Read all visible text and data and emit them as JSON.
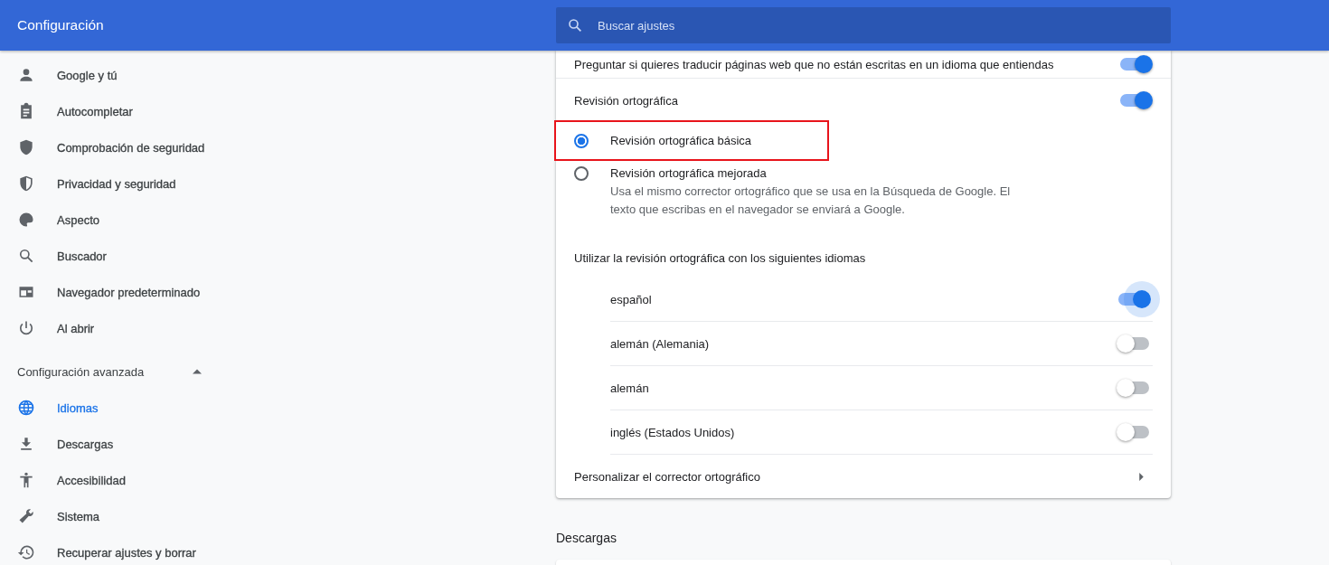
{
  "header": {
    "title": "Configuración",
    "search": {
      "placeholder": "Buscar ajustes"
    }
  },
  "sidebar": {
    "items": [
      {
        "label": "Google y tú",
        "selected": false
      },
      {
        "label": "Autocompletar",
        "selected": false
      },
      {
        "label": "Comprobación de seguridad",
        "selected": false
      },
      {
        "label": "Privacidad y seguridad",
        "selected": false
      },
      {
        "label": "Aspecto",
        "selected": false
      },
      {
        "label": "Buscador",
        "selected": false
      },
      {
        "label": "Navegador predeterminado",
        "selected": false
      },
      {
        "label": "Al abrir",
        "selected": false
      }
    ],
    "advanced": {
      "label": "Configuración avanzada",
      "expanded": true,
      "items": [
        {
          "label": "Idiomas",
          "selected": true
        },
        {
          "label": "Descargas",
          "selected": false
        },
        {
          "label": "Accesibilidad",
          "selected": false
        },
        {
          "label": "Sistema",
          "selected": false
        },
        {
          "label": "Recuperar ajustes y borrar",
          "selected": false
        }
      ]
    }
  },
  "languages_card": {
    "translate": {
      "label": "Preguntar si quieres traducir páginas web que no están escritas en un idioma que entiendas",
      "on": true
    },
    "spellcheck": {
      "label": "Revisión ortográfica",
      "on": true
    },
    "spellcheck_options": [
      {
        "label": "Revisión ortográfica básica",
        "selected": true,
        "highlighted": true
      },
      {
        "label": "Revisión ortográfica mejorada",
        "description": "Usa el mismo corrector ortográfico que se usa en la Búsqueda de Google. El texto que escribas en el navegador se enviará a Google.",
        "selected": false,
        "highlighted": false
      }
    ],
    "languages_heading": "Utilizar la revisión ortográfica con los siguientes idiomas",
    "languages": [
      {
        "label": "español",
        "on": true,
        "focused": true
      },
      {
        "label": "alemán (Alemania)",
        "on": false,
        "focused": false
      },
      {
        "label": "alemán",
        "on": false,
        "focused": false
      },
      {
        "label": "inglés (Estados Unidos)",
        "on": false,
        "focused": false
      }
    ],
    "customize": {
      "label": "Personalizar el corrector ortográfico"
    }
  },
  "downloads_section": {
    "title": "Descargas"
  }
}
